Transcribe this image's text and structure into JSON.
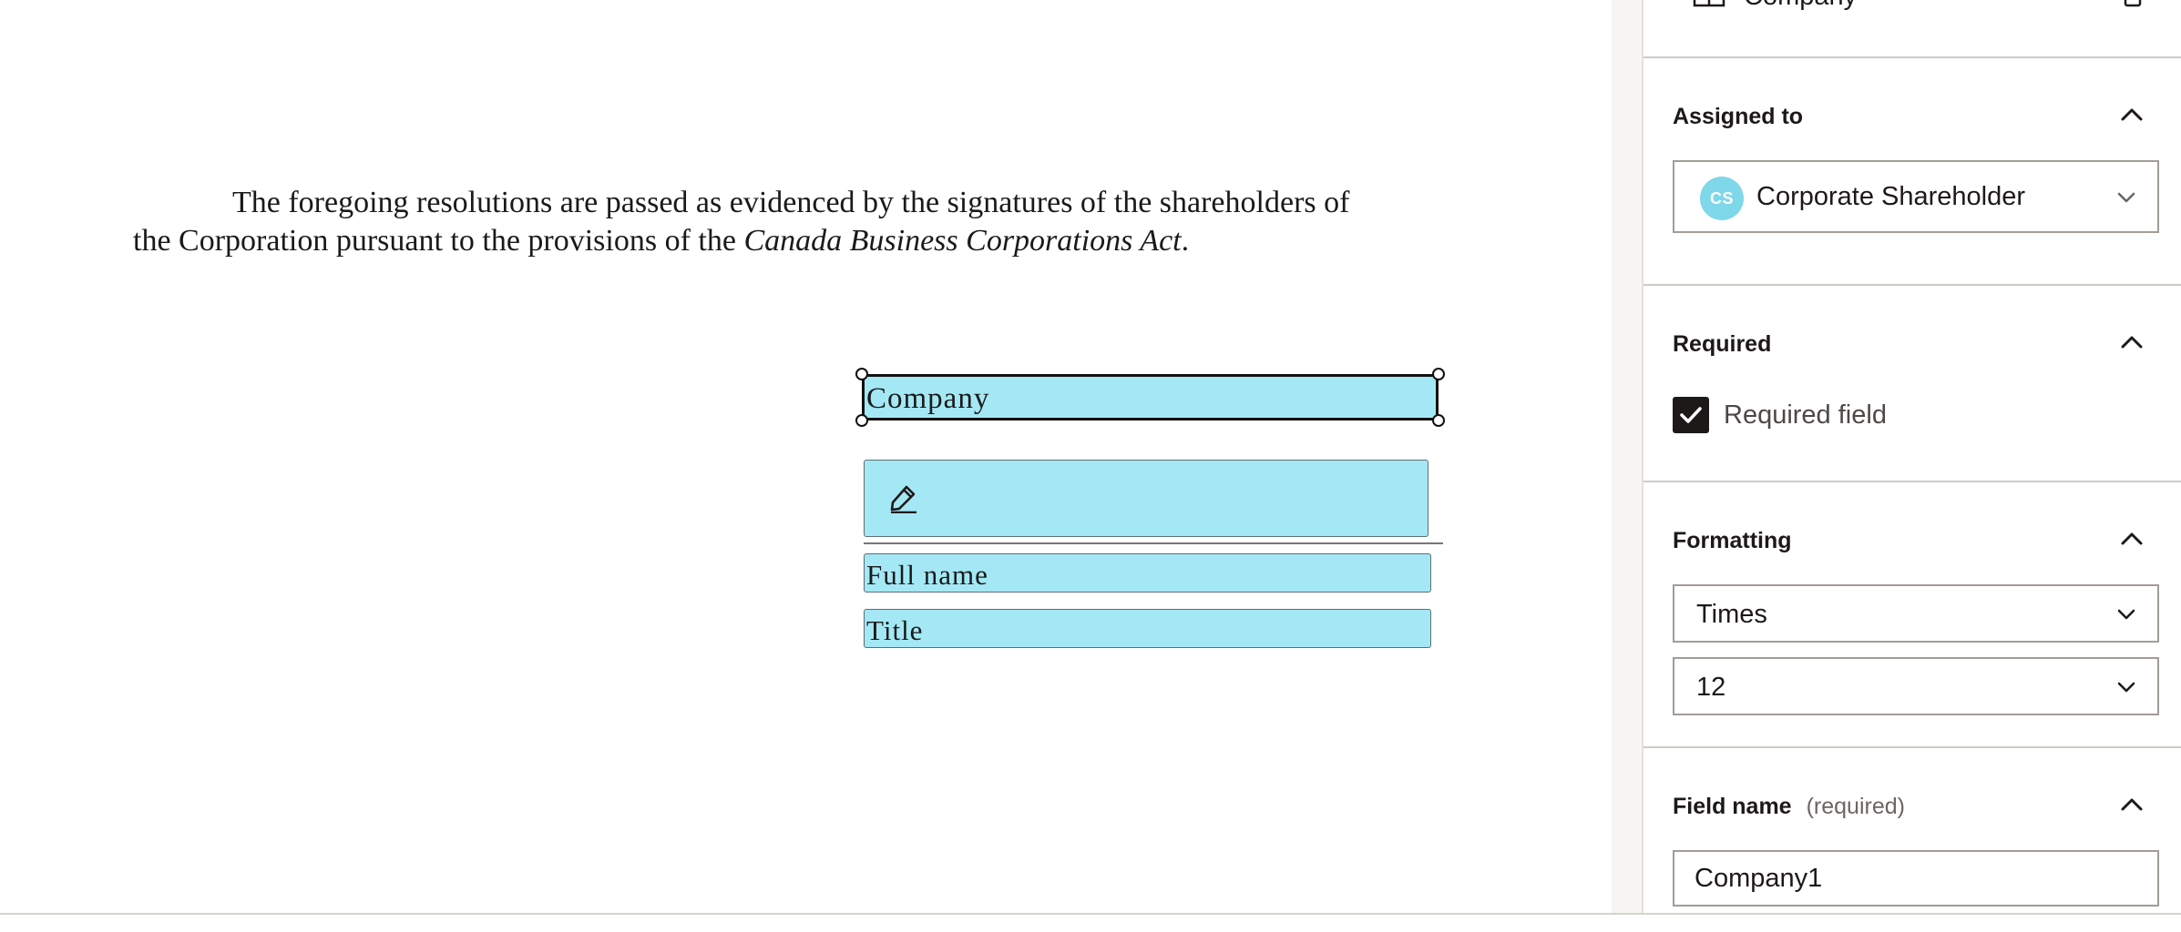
{
  "document": {
    "paragraph": {
      "line1": "The foregoing resolutions are passed as evidenced by the signatures of the shareholders of",
      "line2_prefix": "the Corporation pursuant to the provisions of the ",
      "line2_italic": "Canada Business Corporations Act",
      "line2_suffix": "."
    },
    "fields": {
      "company": "Company",
      "signature_icon": "pen-icon",
      "full_name": "Full name",
      "title": "Title"
    }
  },
  "panel": {
    "top_clipped_label": "Company",
    "assigned_to": {
      "title": "Assigned to",
      "avatar_initials": "CS",
      "selected": "Corporate Shareholder"
    },
    "required": {
      "title": "Required",
      "checkbox_label": "Required field",
      "checked": true
    },
    "formatting": {
      "title": "Formatting",
      "font": "Times",
      "size": "12"
    },
    "field_name": {
      "title": "Field name",
      "hint": "(required)",
      "value": "Company1"
    }
  },
  "colors": {
    "field_fill": "#a4e8f5",
    "avatar": "#7fd7ea",
    "text": "#1e1919",
    "checkbox": "#1e1919"
  }
}
